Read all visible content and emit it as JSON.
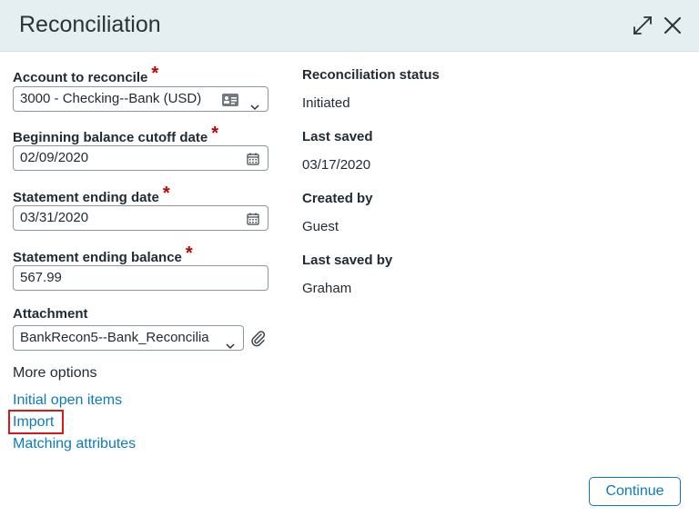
{
  "dialog": {
    "title": "Reconciliation"
  },
  "form": {
    "account": {
      "label": "Account to reconcile",
      "value": "3000 - Checking--Bank (USD)"
    },
    "cutoff": {
      "label": "Beginning balance cutoff date",
      "value": "02/09/2020"
    },
    "end_date": {
      "label": "Statement ending date",
      "value": "03/31/2020"
    },
    "end_balance": {
      "label": "Statement ending balance",
      "value": "567.99"
    },
    "attachment": {
      "label": "Attachment",
      "value": "BankRecon5--Bank_Reconcilia"
    },
    "required_mark": "*"
  },
  "more_options": {
    "heading": "More options",
    "links": [
      "Initial open items",
      "Import",
      "Matching attributes"
    ]
  },
  "info": {
    "status_label": "Reconciliation status",
    "status_value": "Initiated",
    "last_saved_label": "Last saved",
    "last_saved_value": "03/17/2020",
    "created_by_label": "Created by",
    "created_by_value": "Guest",
    "last_saved_by_label": "Last saved by",
    "last_saved_by_value": "Graham"
  },
  "actions": {
    "continue_label": "Continue"
  },
  "colors": {
    "header_bg": "#e5eef0",
    "link": "#0b7cba",
    "required": "#c20000",
    "highlight": "#d61a1a"
  },
  "icons": [
    "expand-icon",
    "close-icon",
    "calendar-icon",
    "contact-card-icon",
    "chevron-down-icon",
    "paperclip-icon"
  ]
}
